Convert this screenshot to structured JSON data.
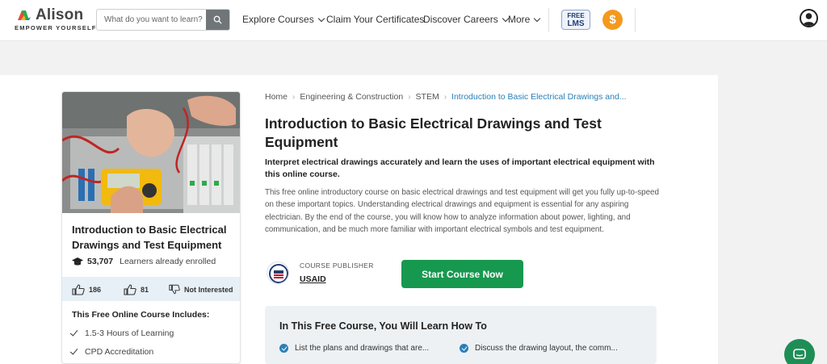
{
  "header": {
    "logo_text": "Alison",
    "logo_tagline": "EMPOWER YOURSELF",
    "search_placeholder": "What do you want to learn?",
    "nav": {
      "explore": "Explore Courses",
      "certificates": "Claim Your Certificates",
      "careers": "Discover Careers",
      "more": "More"
    },
    "free_lms_line1": "FREE",
    "free_lms_line2": "LMS",
    "coin_symbol": "$"
  },
  "card": {
    "title": "Introduction to Basic Electrical Drawings and Test Equipment",
    "learners_count": "53,707",
    "learners_text": "Learners already enrolled",
    "likes": "186",
    "dislikes": "81",
    "not_interested": "Not Interested",
    "includes_title": "This Free Online Course Includes:",
    "includes": [
      "1.5-3 Hours of Learning",
      "CPD Accreditation"
    ]
  },
  "breadcrumb": {
    "items": [
      "Home",
      "Engineering & Construction",
      "STEM"
    ],
    "current": "Introduction to Basic Electrical Drawings and..."
  },
  "course": {
    "title": "Introduction to Basic Electrical Drawings and Test Equipment",
    "subtitle": "Interpret electrical drawings accurately and learn the uses of important electrical equipment with this online course.",
    "description": "This free online introductory course on basic electrical drawings and test equipment will get you fully up-to-speed on these important topics. Understanding electrical drawings and equipment is essential for any aspiring electrician. By the end of the course, you will know how to analyze information about power, lighting, and communication, and be much more familiar with important electrical symbols and test equipment.",
    "publisher_label": "COURSE PUBLISHER",
    "publisher_name": "USAID",
    "start_button": "Start Course Now"
  },
  "learn": {
    "title": "In This Free Course, You Will Learn How To",
    "items": [
      "List the plans and drawings that are...",
      "Discuss the drawing layout, the comm..."
    ]
  },
  "colors": {
    "brand_green": "#17984f",
    "link_blue": "#2a7fb8",
    "coin_orange": "#f39a1e"
  }
}
